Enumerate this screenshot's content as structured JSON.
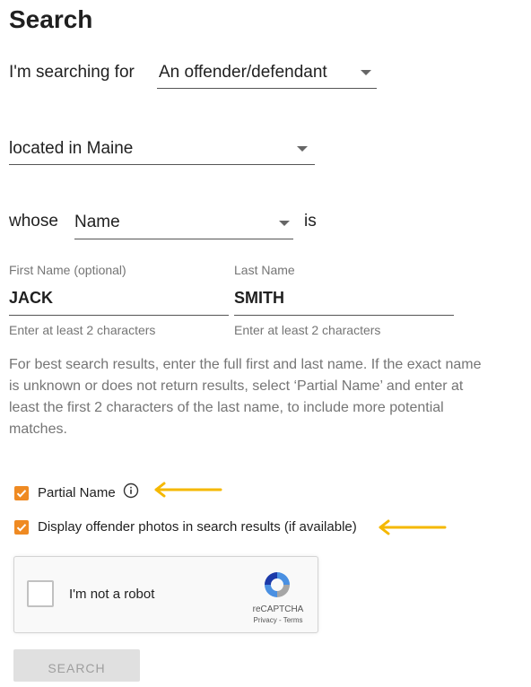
{
  "page_title": "Search",
  "searching_for": {
    "label": "I'm searching for",
    "value": "An offender/defendant"
  },
  "located_in": {
    "value": "located in Maine"
  },
  "whose": {
    "label": "whose",
    "value": "Name",
    "suffix": "is"
  },
  "first_name": {
    "label": "First Name (optional)",
    "value": "JACK",
    "hint": "Enter at least 2 characters"
  },
  "last_name": {
    "label": "Last Name",
    "value": "SMITH",
    "hint": "Enter at least 2 characters"
  },
  "info_lines": [
    "For best search results, enter the full first and last name. If the exact name",
    "is unknown or does not return results, select ‘Partial Name’ and enter at",
    "least the first 2 characters of the last name, to include more potential",
    "matches."
  ],
  "partial_name": {
    "label": "Partial Name",
    "checked": true
  },
  "display_photos": {
    "label": "Display offender photos in search results (if available)",
    "checked": true
  },
  "recaptcha": {
    "label": "I'm not a robot",
    "brand": "reCAPTCHA",
    "links": "Privacy - Terms"
  },
  "search_button": {
    "label": "SEARCH"
  },
  "colors": {
    "checkbox": "#ef8a22",
    "arrow": "#f5b800",
    "button_bg": "#e0e0e0"
  }
}
